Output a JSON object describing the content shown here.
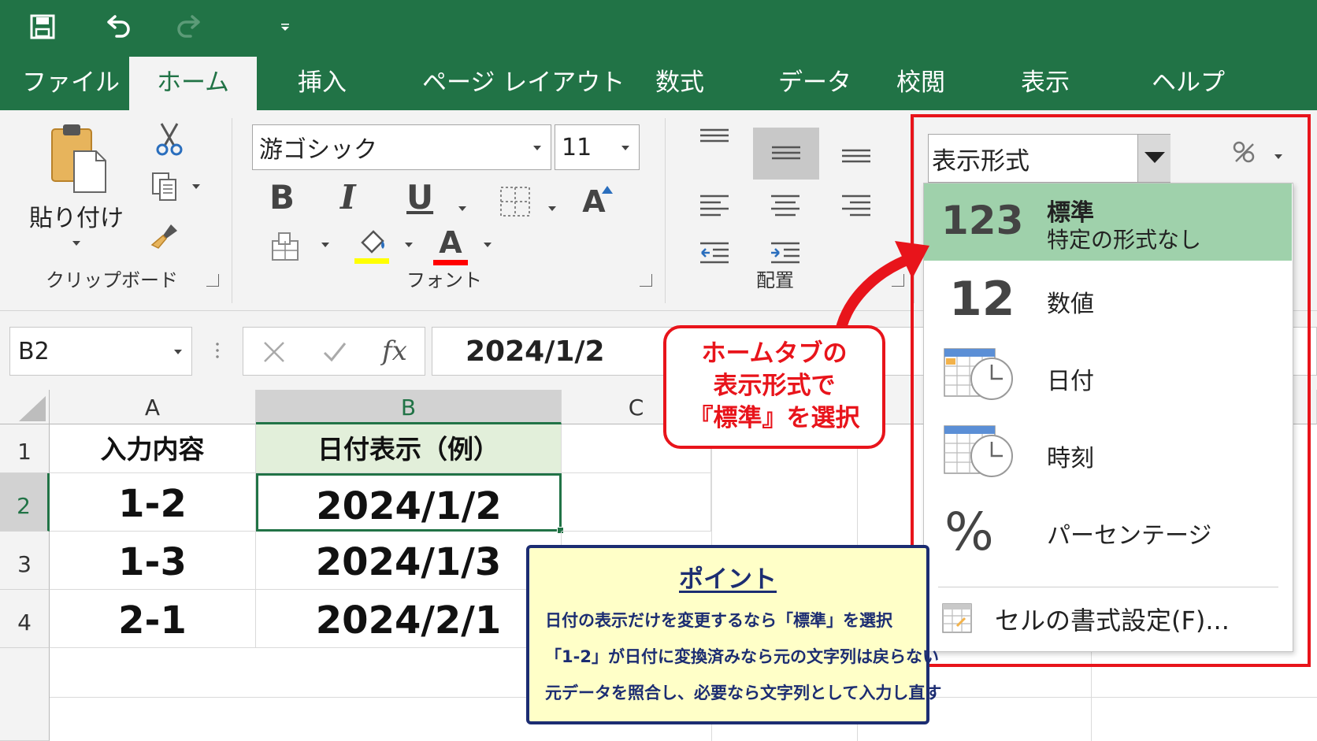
{
  "quick_access": {
    "icons": [
      "save-icon",
      "undo-icon",
      "redo-icon",
      "customize-qat-icon"
    ]
  },
  "tabs": [
    {
      "label": "ファイル"
    },
    {
      "label": "ホーム",
      "active": true
    },
    {
      "label": "挿入"
    },
    {
      "label": "ページ レイアウト"
    },
    {
      "label": "数式"
    },
    {
      "label": "データ"
    },
    {
      "label": "校閲"
    },
    {
      "label": "表示"
    },
    {
      "label": "ヘルプ"
    }
  ],
  "ribbon": {
    "clipboard": {
      "paste_label": "貼り付け",
      "group_label": "クリップボード"
    },
    "font": {
      "font_name": "游ゴシック",
      "font_size": "11",
      "bold": "B",
      "italic": "I",
      "underline": "U",
      "font_color_glyph": "A",
      "grow_glyph": "A",
      "group_label": "フォント",
      "highlight_color": "#ffff00",
      "font_color": "#ff0000"
    },
    "alignment": {
      "group_label": "配置"
    },
    "number": {
      "format_value": "表示形式"
    }
  },
  "formula_bar": {
    "name_box": "B2",
    "fx": "fx",
    "content": "2024/1/2"
  },
  "sheet": {
    "columns": [
      "A",
      "B",
      "C"
    ],
    "rows": [
      "1",
      "2",
      "3",
      "4"
    ],
    "selected_cell": "B2",
    "cells": {
      "A1": "入力内容",
      "B1": "日付表示（例）",
      "A2": "1-2",
      "B2": "2024/1/2",
      "A3": "1-3",
      "B3": "2024/1/3",
      "A4": "2-1",
      "B4": "2024/2/1"
    }
  },
  "format_menu": {
    "items": [
      {
        "glyph": "123",
        "label": "標準",
        "sub": "特定の形式なし",
        "icon": "general-format-icon",
        "highlighted": true
      },
      {
        "glyph": "12",
        "label": "数値",
        "icon": "number-format-icon"
      },
      {
        "glyph": "",
        "label": "日付",
        "icon": "date-format-icon"
      },
      {
        "glyph": "",
        "label": "時刻",
        "icon": "time-format-icon"
      },
      {
        "glyph": "%",
        "label": "パーセンテージ",
        "icon": "percent-format-icon"
      }
    ],
    "more": "セルの書式設定(F)...",
    "more_shortcut_letter": "F",
    "highlight_color": "#9fd1ab"
  },
  "callout": {
    "lines": [
      "ホームタブの",
      "表示形式で",
      "『標準』を選択"
    ],
    "color": "#e8141b"
  },
  "point_box": {
    "title": "ポイント",
    "lines": [
      "日付の表示だけを変更するなら「標準」を選択",
      "「1-2」が日付に変換済みなら元の文字列は戻らない",
      "元データを照合し、必要なら文字列として入力し直す"
    ],
    "color": "#1c2d72",
    "background": "#ffffc8"
  },
  "theme": {
    "excel_green": "#217346",
    "ribbon_bg": "#f3f3f3"
  }
}
